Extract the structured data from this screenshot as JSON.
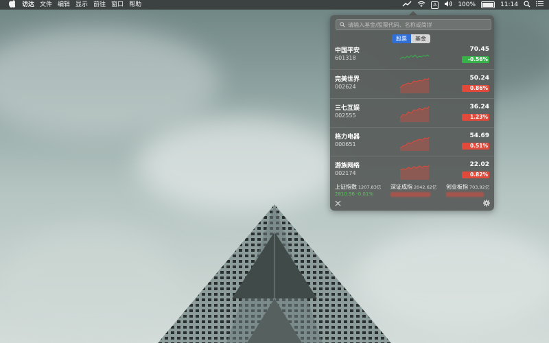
{
  "menubar": {
    "app_name": "访达",
    "menus": [
      "文件",
      "编辑",
      "显示",
      "前往",
      "窗口",
      "帮助"
    ],
    "input_source": "A",
    "battery": "100%",
    "time": "11:14"
  },
  "popover": {
    "search_placeholder": "请输入基金/股票代码、名称或简拼",
    "tabs": [
      {
        "label": "股票",
        "active": true
      },
      {
        "label": "基金",
        "active": false
      }
    ],
    "stocks": [
      {
        "name": "中国平安",
        "code": "601318",
        "price": "70.45",
        "change": "-0.56%",
        "direction": "down"
      },
      {
        "name": "完美世界",
        "code": "002624",
        "price": "50.24",
        "change": "0.86%",
        "direction": "up"
      },
      {
        "name": "三七互娱",
        "code": "002555",
        "price": "36.24",
        "change": "1.23%",
        "direction": "up"
      },
      {
        "name": "格力电器",
        "code": "000651",
        "price": "54.69",
        "change": "0.51%",
        "direction": "up"
      },
      {
        "name": "游族网络",
        "code": "002174",
        "price": "22.02",
        "change": "0.82%",
        "direction": "up"
      }
    ],
    "indices": [
      {
        "name": "上证指数",
        "volume": "1207.83亿",
        "value": "2810.96 -0.01%",
        "color": "#4fc94f"
      },
      {
        "name": "深证成指",
        "volume": "2042.62亿",
        "value": "",
        "color": "#e1493a"
      },
      {
        "name": "创业板指",
        "volume": "703.92亿",
        "value": "",
        "color": "#e1493a"
      }
    ]
  },
  "colors": {
    "up": "#e1493a",
    "down": "#37b34a"
  }
}
